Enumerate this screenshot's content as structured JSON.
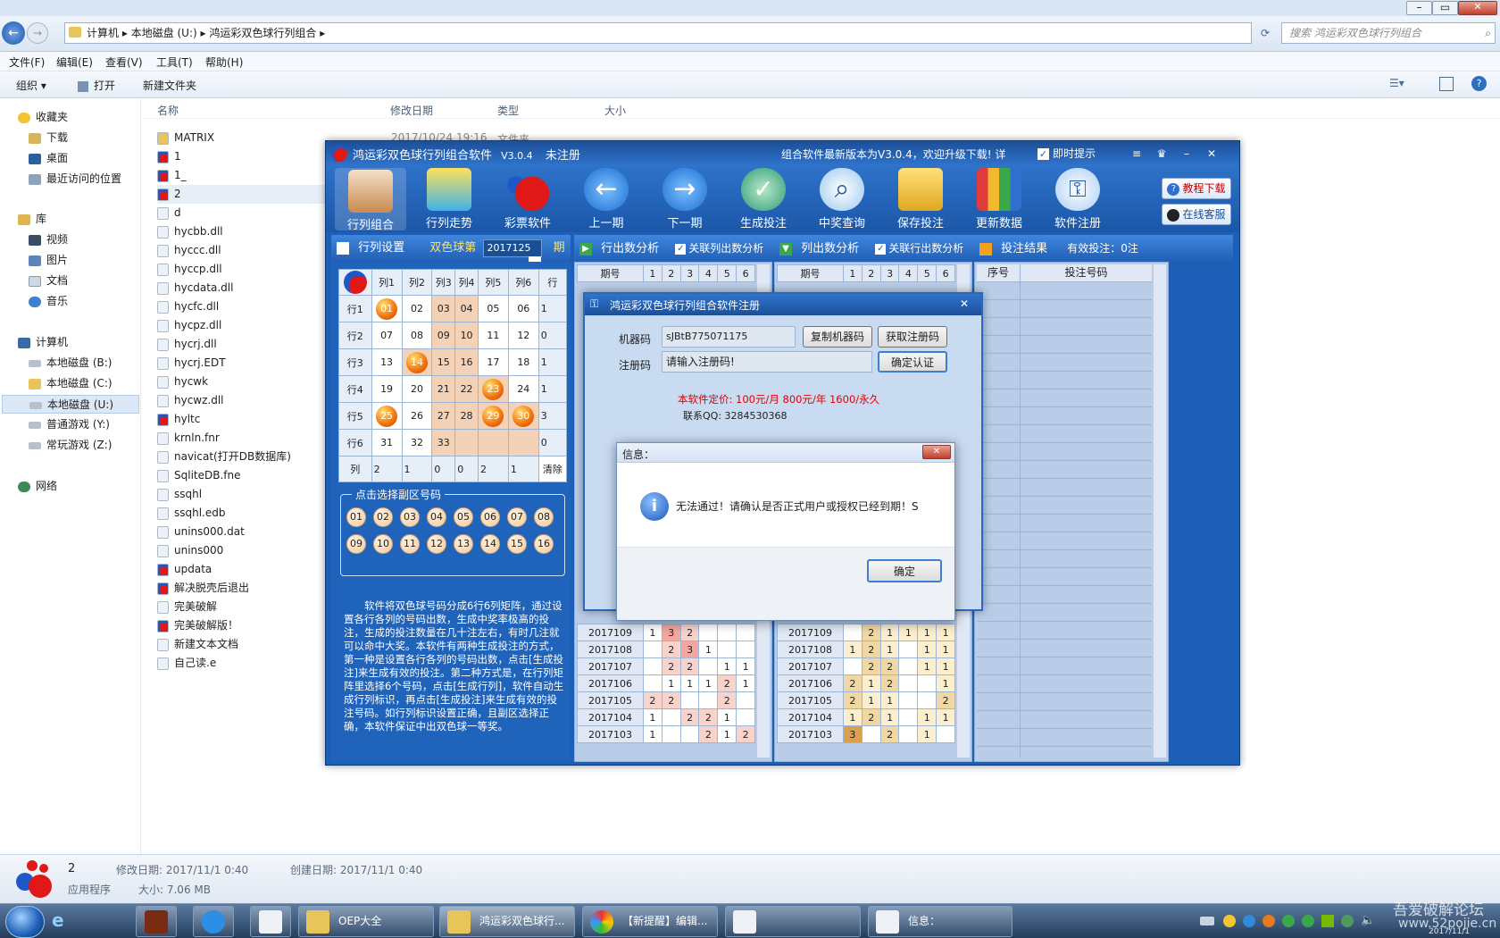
{
  "explorer": {
    "path": [
      "计算机",
      "本地磁盘 (U:)",
      "鸿运彩双色球行列组合"
    ],
    "search_placeholder": "搜索 鸿运彩双色球行列组合",
    "menu": [
      "文件(F)",
      "编辑(E)",
      "查看(V)",
      "工具(T)",
      "帮助(H)"
    ],
    "toolbar": [
      "组织 ▾",
      "打开",
      "新建文件夹"
    ],
    "nav": {
      "favorites": "收藏夹",
      "fav_items": [
        "下载",
        "桌面",
        "最近访问的位置"
      ],
      "libraries": "库",
      "lib_items": [
        "视频",
        "图片",
        "文档",
        "音乐"
      ],
      "computer": "计算机",
      "drives": [
        "本地磁盘 (B:)",
        "本地磁盘 (C:)",
        "本地磁盘 (U:)",
        "普通游戏 (Y:)",
        "常玩游戏 (Z:)"
      ],
      "network": "网络"
    },
    "columns": [
      "名称",
      "修改日期",
      "类型",
      "大小"
    ],
    "first_row_date": "2017/10/24 19:16",
    "first_row_type": "文件夹",
    "files": [
      "MATRIX",
      "1",
      "1_",
      "2",
      "d",
      "hycbb.dll",
      "hyccc.dll",
      "hyccp.dll",
      "hycdata.dll",
      "hycfc.dll",
      "hycpz.dll",
      "hycrj.dll",
      "hycrj.EDT",
      "hycwk",
      "hycwz.dll",
      "hyltc",
      "krnln.fnr",
      "navicat(打开DB数据库)",
      "SqliteDB.fne",
      "ssqhl",
      "ssqhl.edb",
      "unins000.dat",
      "unins000",
      "updata",
      "解决脱壳后退出",
      "完美破解",
      "完美破解版！",
      "新建文本文档",
      "自己读.e"
    ],
    "status": {
      "name": "2",
      "type": "应用程序",
      "modified": "修改日期: 2017/11/1 0:40",
      "created": "创建日期: 2017/11/1 0:40",
      "size": "大小: 7.06 MB"
    }
  },
  "app": {
    "title": "鸿运彩双色球行列组合软件",
    "version": "V3.0.4",
    "reg_state": "未注册",
    "notice": "组合软件最新版本为V3.0.4，欢迎升级下载! 详",
    "instant_tip": "即时提示",
    "tools": [
      "行列组合",
      "行列走势",
      "彩票软件",
      "上一期",
      "下一期",
      "生成投注",
      "中奖查询",
      "保存投注",
      "更新数据",
      "软件注册"
    ],
    "side_buttons": [
      "教程下载",
      "在线客服"
    ],
    "row_settings": {
      "title": "行列设置",
      "label": "双色球第",
      "period": "2017125",
      "suffix": "期",
      "headers": [
        "列1",
        "列2",
        "列3",
        "列4",
        "列5",
        "列6",
        "行"
      ],
      "rows": [
        {
          "label": "行1",
          "cells": [
            "01",
            "02",
            "03",
            "04",
            "05",
            "06"
          ],
          "hl": [
            1,
            0,
            0,
            0,
            0,
            0
          ],
          "count": "1"
        },
        {
          "label": "行2",
          "cells": [
            "07",
            "08",
            "09",
            "10",
            "11",
            "12"
          ],
          "hl": [
            0,
            0,
            0,
            0,
            0,
            0
          ],
          "count": "0"
        },
        {
          "label": "行3",
          "cells": [
            "13",
            "14",
            "15",
            "16",
            "17",
            "18"
          ],
          "hl": [
            0,
            1,
            0,
            0,
            0,
            0
          ],
          "count": "1"
        },
        {
          "label": "行4",
          "cells": [
            "19",
            "20",
            "21",
            "22",
            "23",
            "24"
          ],
          "hl": [
            0,
            0,
            0,
            0,
            1,
            0
          ],
          "count": "1"
        },
        {
          "label": "行5",
          "cells": [
            "25",
            "26",
            "27",
            "28",
            "29",
            "30"
          ],
          "hl": [
            1,
            0,
            0,
            0,
            1,
            1
          ],
          "count": "3"
        },
        {
          "label": "行6",
          "cells": [
            "31",
            "32",
            "33",
            "",
            "",
            ""
          ],
          "hl": [
            0,
            0,
            0,
            0,
            0,
            0
          ],
          "count": "0"
        }
      ],
      "col_label": "列",
      "col_counts": [
        "2",
        "1",
        "0",
        "0",
        "2",
        "1"
      ],
      "clear": "清除"
    },
    "blue": {
      "title": "点击选择副区号码",
      "balls": [
        "01",
        "02",
        "03",
        "04",
        "05",
        "06",
        "07",
        "08",
        "09",
        "10",
        "11",
        "12",
        "13",
        "14",
        "15",
        "16"
      ]
    },
    "description": "软件将双色球号码分成6行6列矩阵，通过设置各行各列的号码出数，生成中奖率极高的投注，生成的投注数量在几十注左右，有时几注就可以命中大奖。本软件有两种生成投注的方式，第一种是设置各行各列的号码出数，点击[生成投注]来生成有效的投注。第二种方式是，在行列矩阵里选择6个号码，点击[生成行列]，软件自动生成行列标识，再点击[生成投注]来生成有效的投注号码。如行列标识设置正确，且副区选择正确，本软件保证中出双色球一等奖。",
    "row_analysis": {
      "title": "行出数分析",
      "link": "关联列出数分析",
      "headers": [
        "期号",
        "1",
        "2",
        "3",
        "4",
        "5",
        "6"
      ],
      "rows": [
        {
          "p": "2017109",
          "v": [
            "1",
            "3",
            "2",
            "",
            "",
            ""
          ]
        },
        {
          "p": "2017108",
          "v": [
            "",
            "2",
            "3",
            "1",
            "",
            ""
          ]
        },
        {
          "p": "2017107",
          "v": [
            "",
            "2",
            "2",
            "",
            "1",
            "1"
          ]
        },
        {
          "p": "2017106",
          "v": [
            "",
            "1",
            "1",
            "1",
            "2",
            "1"
          ]
        },
        {
          "p": "2017105",
          "v": [
            "2",
            "2",
            "",
            "",
            "2",
            ""
          ]
        },
        {
          "p": "2017104",
          "v": [
            "1",
            "",
            "2",
            "2",
            "1",
            ""
          ]
        },
        {
          "p": "2017103",
          "v": [
            "1",
            "",
            "",
            "2",
            "1",
            "2"
          ]
        }
      ]
    },
    "col_analysis": {
      "title": "列出数分析",
      "link": "关联行出数分析",
      "headers": [
        "期号",
        "1",
        "2",
        "3",
        "4",
        "5",
        "6"
      ],
      "rows": [
        {
          "p": "2017109",
          "v": [
            "",
            "2",
            "1",
            "1",
            "1",
            "1"
          ]
        },
        {
          "p": "2017108",
          "v": [
            "1",
            "2",
            "1",
            "",
            "1",
            "1"
          ]
        },
        {
          "p": "2017107",
          "v": [
            "",
            "2",
            "2",
            "",
            "1",
            "1"
          ]
        },
        {
          "p": "2017106",
          "v": [
            "2",
            "1",
            "2",
            "",
            "",
            "1"
          ]
        },
        {
          "p": "2017105",
          "v": [
            "2",
            "1",
            "1",
            "",
            "",
            "2"
          ]
        },
        {
          "p": "2017104",
          "v": [
            "1",
            "2",
            "1",
            "",
            "1",
            "1"
          ]
        },
        {
          "p": "2017103",
          "v": [
            "3",
            "",
            "2",
            "",
            "1",
            ""
          ]
        }
      ]
    },
    "result": {
      "title": "投注结果",
      "valid": "有效投注：0注",
      "headers": [
        "序号",
        "投注号码"
      ]
    }
  },
  "reg_dialog": {
    "title": "鸿运彩双色球行列组合软件注册",
    "machine_label": "机器码",
    "machine_value": "sJBtB775071175",
    "copy_btn": "复制机器码",
    "get_btn": "获取注册码",
    "code_label": "注册码",
    "code_value": "请输入注册码!",
    "confirm_btn": "确定认证",
    "price": "本软件定价: 100元/月 800元/年 1600/永久",
    "contact": "联系QQ: 3284530368"
  },
  "msg_dialog": {
    "title": "信息：",
    "text": "无法通过！请确认是否正式用户或授权已经到期！S",
    "ok": "确定"
  },
  "taskbar": {
    "items": [
      "OEP大全",
      "鸿运彩双色球行...",
      "【新提醒】编辑...",
      "",
      "信息："
    ],
    "watermark": "吾爱破解论坛",
    "watermark2": "www.52pojie.cn",
    "clock": "2017/11/1"
  },
  "colors": {
    "accent": "#1d5fb6",
    "highlight": "#f47a10",
    "red": "#e00000"
  }
}
